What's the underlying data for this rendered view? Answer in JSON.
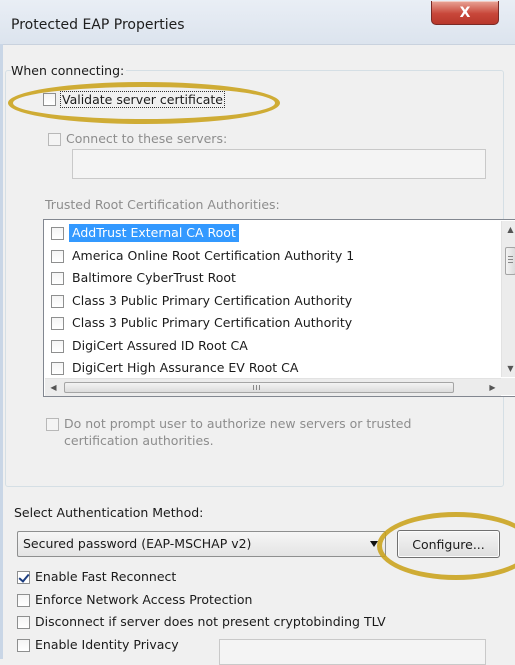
{
  "window": {
    "title": "Protected EAP Properties",
    "close_glyph": "X"
  },
  "connecting": {
    "heading": "When connecting:",
    "validate_cert": {
      "label": "Validate server certificate",
      "checked": false
    },
    "connect_servers": {
      "label": "Connect to these servers:",
      "checked": false,
      "value": ""
    },
    "trusted_root_heading": "Trusted Root Certification Authorities:",
    "authorities": [
      {
        "label": "AddTrust External CA Root",
        "checked": false,
        "selected": true
      },
      {
        "label": "America Online Root Certification Authority 1",
        "checked": false,
        "selected": false
      },
      {
        "label": "Baltimore CyberTrust Root",
        "checked": false,
        "selected": false
      },
      {
        "label": "Class 3 Public Primary Certification Authority",
        "checked": false,
        "selected": false
      },
      {
        "label": "Class 3 Public Primary Certification Authority",
        "checked": false,
        "selected": false
      },
      {
        "label": "DigiCert Assured ID Root CA",
        "checked": false,
        "selected": false
      },
      {
        "label": "DigiCert High Assurance EV Root CA",
        "checked": false,
        "selected": false
      }
    ],
    "no_prompt": {
      "line1": "Do not prompt user to authorize new servers or trusted",
      "line2": "certification authorities.",
      "checked": false
    }
  },
  "auth": {
    "heading": "Select Authentication Method:",
    "method": "Secured password (EAP-MSCHAP v2)",
    "configure_label": "Configure..."
  },
  "options": [
    {
      "label": "Enable Fast Reconnect",
      "checked": true
    },
    {
      "label": "Enforce Network Access Protection",
      "checked": false
    },
    {
      "label": "Disconnect if server does not present cryptobinding TLV",
      "checked": false
    },
    {
      "label": "Enable Identity Privacy",
      "checked": false
    }
  ],
  "identity_privacy_value": "",
  "highlight_color": "#c9a21a"
}
